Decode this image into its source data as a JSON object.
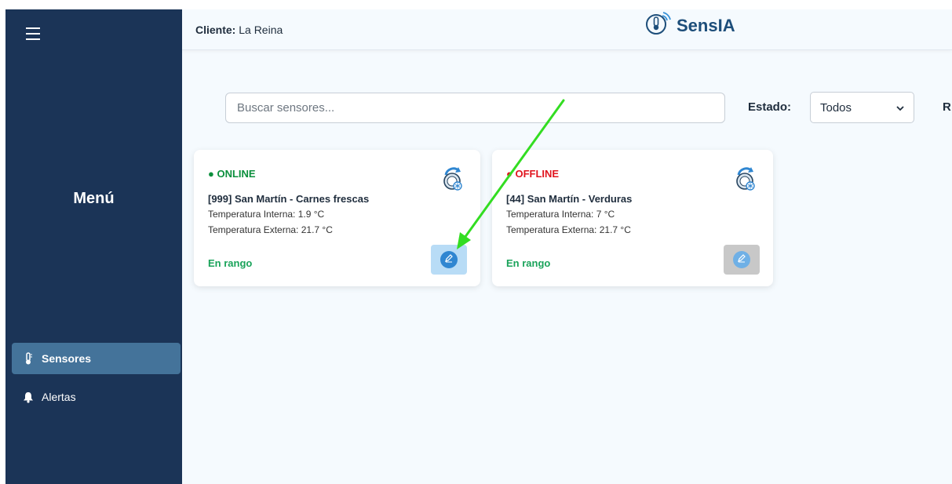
{
  "header": {
    "client_label": "Cliente:",
    "client_name": "La Reina",
    "brand": "SensIA"
  },
  "sidebar": {
    "menu_title": "Menú",
    "items": [
      {
        "label": "Sensores",
        "icon": "thermometer-icon",
        "active": true
      },
      {
        "label": "Alertas",
        "icon": "bell-icon",
        "active": false
      }
    ]
  },
  "filters": {
    "search_placeholder": "Buscar sensores...",
    "estado_label": "Estado:",
    "estado_value": "Todos",
    "cut_label": "R"
  },
  "sensors": [
    {
      "status": "● ONLINE",
      "name": "[999] San Martín - Carnes frescas",
      "temp_internal": "Temperatura Interna: 1.9 °C",
      "temp_external": "Temperatura Externa: 21.7 °C",
      "range": "En rango"
    },
    {
      "status": "● OFFLINE",
      "name": "[44] San Martín - Verduras",
      "temp_internal": "Temperatura Interna: 7 °C",
      "temp_external": "Temperatura Externa: 21.7 °C",
      "range": "En rango"
    }
  ],
  "colors": {
    "sidebar_bg": "#1b3457",
    "sidebar_active": "#44739a",
    "online": "#0a8f3c",
    "offline": "#e0141e",
    "in_range": "#1aa35a",
    "edit_active_bg": "#b8dcf6",
    "edit_inactive_bg": "#c8c8c8",
    "annotation_arrow": "#33dd22"
  }
}
